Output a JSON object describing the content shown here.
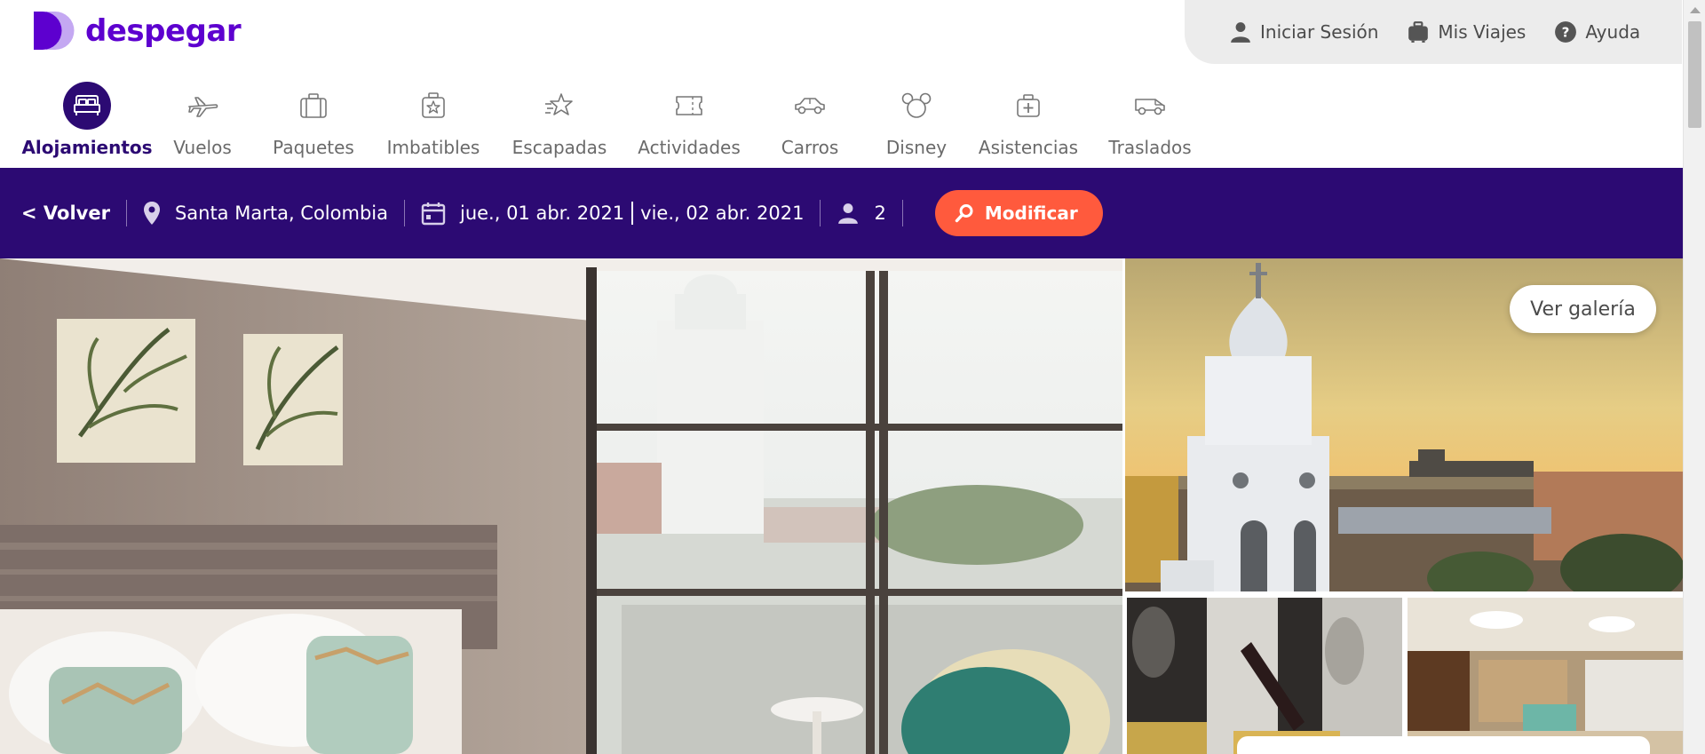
{
  "brand": {
    "name": "despegar",
    "color": "#5d00cf"
  },
  "user_bar": {
    "items": [
      {
        "label": "Iniciar Sesión",
        "icon": "user-icon"
      },
      {
        "label": "Mis Viajes",
        "icon": "suitcase-icon"
      },
      {
        "label": "Ayuda",
        "icon": "help-icon"
      }
    ]
  },
  "products": [
    {
      "label": "Alojamientos",
      "icon": "bed-icon",
      "active": true
    },
    {
      "label": "Vuelos",
      "icon": "plane-icon"
    },
    {
      "label": "Paquetes",
      "icon": "package-icon"
    },
    {
      "label": "Imbatibles",
      "icon": "unbeatable-icon"
    },
    {
      "label": "Escapadas",
      "icon": "getaway-star-icon"
    },
    {
      "label": "Actividades",
      "icon": "ticket-icon"
    },
    {
      "label": "Carros",
      "icon": "car-icon"
    },
    {
      "label": "Disney",
      "icon": "mickey-icon"
    },
    {
      "label": "Asistencias",
      "icon": "medical-kit-icon"
    },
    {
      "label": "Traslados",
      "icon": "van-icon"
    }
  ],
  "search": {
    "back_label": "< Volver",
    "destination": "Santa Marta, Colombia",
    "checkin": "jue., 01 abr. 2021",
    "checkout": "vie., 02 abr. 2021",
    "guests": "2",
    "modify_label": "Modificar"
  },
  "gallery": {
    "view_gallery_label": "Ver galería"
  },
  "colors": {
    "search_bar_bg": "#2c0a73",
    "modify_button": "#ff5a3d",
    "active_nav": "#2c0a73"
  }
}
